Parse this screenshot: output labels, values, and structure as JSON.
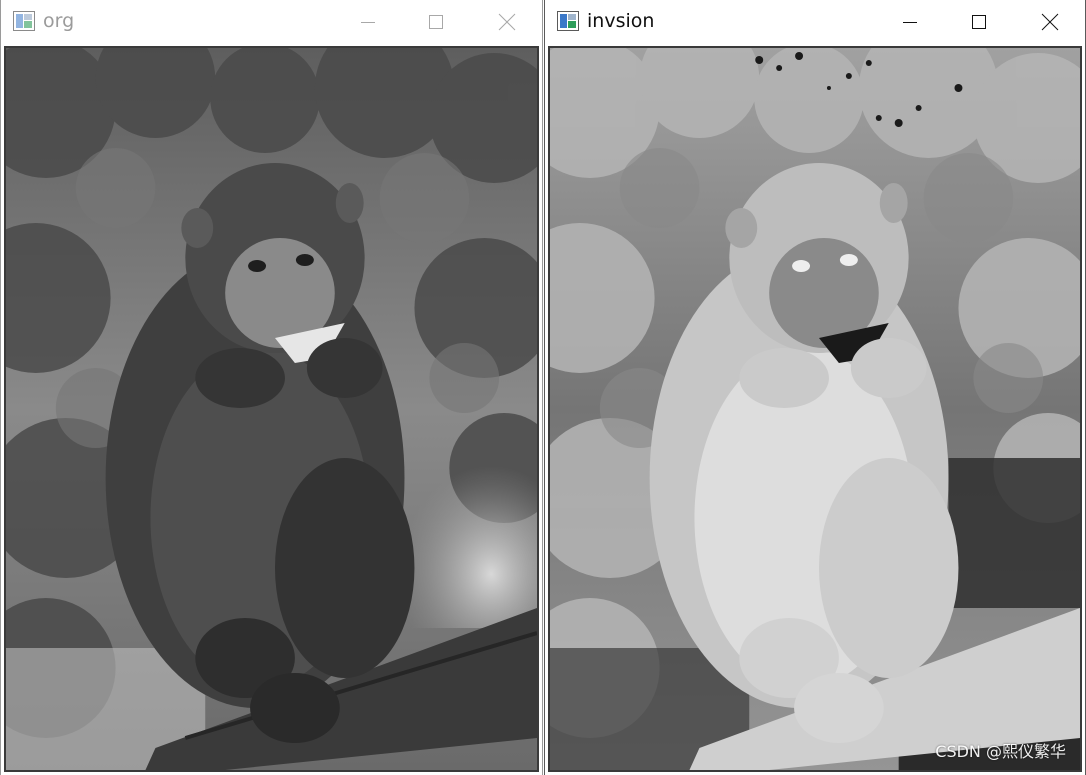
{
  "windows": {
    "original": {
      "title": "org",
      "title_color": "#9b9b9b",
      "image_description": "Grayscale photo of a monkey eating, sitting on a log in a misty forest"
    },
    "inversion": {
      "title": "invsion",
      "title_color": "#111111",
      "image_description": "Color-inverted (negative) version of the same monkey photo"
    }
  },
  "controls": {
    "minimize_icon": "minimize-icon",
    "maximize_icon": "maximize-icon",
    "close_icon": "close-icon"
  },
  "watermark": {
    "text": "CSDN @熙仪繁华"
  },
  "colors": {
    "title_bar_bg": "#ffffff",
    "inactive_text": "#9b9b9b",
    "active_text": "#111111",
    "app_icon_green": "#2e9d5a",
    "app_icon_blue": "#3a78c9"
  }
}
